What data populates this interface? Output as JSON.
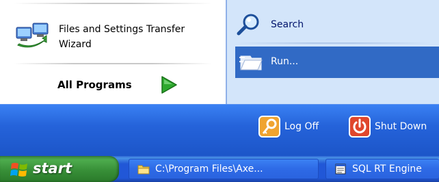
{
  "start_menu": {
    "left_pane": {
      "pinned_items": [
        {
          "label_line1": "Files and Settings Transfer",
          "label_line2": "Wizard",
          "icon": "files-settings-transfer-icon"
        }
      ],
      "all_programs_label": "All Programs",
      "all_programs_icon": "green-arrow-icon"
    },
    "right_pane": {
      "items": [
        {
          "label": "Search",
          "icon": "search-icon"
        },
        {
          "label": "Run...",
          "icon": "run-icon",
          "highlighted": true
        }
      ]
    },
    "footer": {
      "log_off_label": "Log Off",
      "shut_down_label": "Shut Down"
    }
  },
  "taskbar": {
    "start_label": "start",
    "tasks": [
      {
        "label": "C:\\Program Files\\Axe...",
        "icon": "folder-icon"
      },
      {
        "label": "SQL RT Engine",
        "icon": "application-window-icon"
      }
    ]
  },
  "colors": {
    "highlight": "#316ac5",
    "taskbar_blue": "#2157d7",
    "start_green": "#3c8a3c",
    "right_pane_bg": "#d3e5fa"
  }
}
